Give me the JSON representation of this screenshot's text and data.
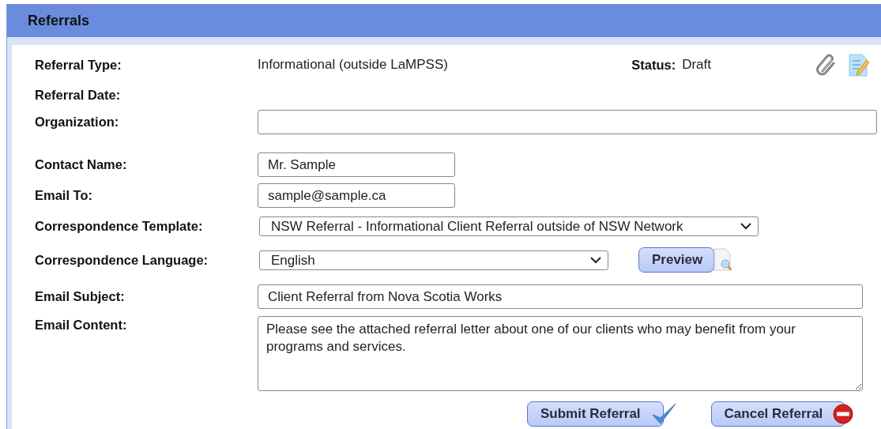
{
  "panel": {
    "title": "Referrals"
  },
  "header": {
    "label": "Referral Type:",
    "value": "Informational (outside LaMPSS)",
    "status_label": "Status:",
    "status_value": "Draft"
  },
  "fields": [
    {
      "kind": "static",
      "label": "Referral Date:"
    },
    {
      "kind": "input",
      "label": "Organization:"
    },
    {
      "kind": "input",
      "label": "Contact Name:",
      "value": "Mr. Sample"
    },
    {
      "kind": "input",
      "label": "Email To:",
      "value": "sample@sample.ca"
    },
    {
      "kind": "select",
      "label": "Correspondence Template:",
      "value": "NSW Referral - Informational Client Referral outside of NSW Network"
    },
    {
      "kind": "select",
      "label": "Correspondence Language:",
      "value": "English",
      "button": "Preview"
    },
    {
      "kind": "input",
      "label": "Email Subject:",
      "value": "Client Referral from Nova Scotia Works"
    },
    {
      "kind": "textarea",
      "label": "Email Content:",
      "value": "Please see the attached referral letter about one of our clients who may benefit from your programs and services."
    }
  ],
  "buttons": [
    {
      "kind": "submit",
      "label": "Submit Referral"
    },
    {
      "kind": "cancel",
      "label": "Cancel Referral"
    }
  ]
}
